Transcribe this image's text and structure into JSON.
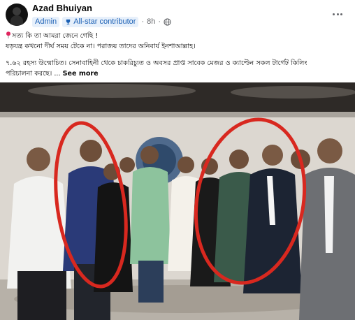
{
  "post": {
    "author": "Azad Bhuiyan",
    "role_badge": "Admin",
    "contributor_badge": "All-star contributor",
    "separator": "·",
    "time": "8h",
    "privacy_icon": "globe-icon",
    "more_icon": "more-horizontal-icon"
  },
  "text": {
    "line1": "সত্য কি তা আমরা জেনে গেছি !",
    "line2": "ষড়যন্ত্র কখনো দীর্ঘ সময় টেকে না। পরাজয় তাদের অনিবার্য ইনশাআল্লাহ।",
    "line3": "৭.৬২ রহস্য উন্মোচিত। সেনাবাহিনী থেকে চাকরিচ্যুত ও অবসর প্রাপ্ত সাবেক মেজর ও ক্যাপ্টেন সকল টার্গেট কিলিং",
    "line4": "পরিচালনা করছে। ...",
    "see_more": "See more"
  },
  "photo": {
    "icon": "group-photo-image",
    "annotation_color": "#d8281f"
  }
}
